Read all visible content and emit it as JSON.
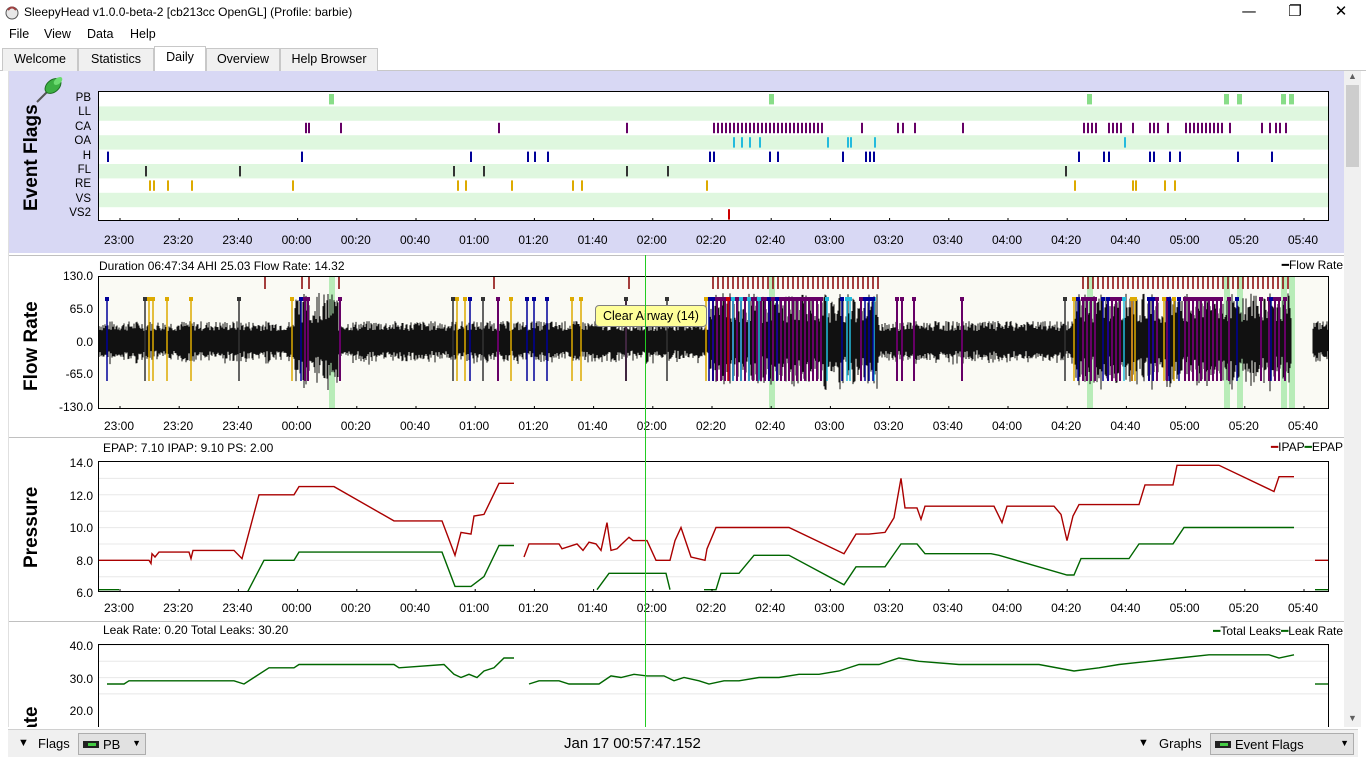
{
  "window": {
    "title": "SleepyHead v1.0.0-beta-2 [cb213cc OpenGL] (Profile: barbie)",
    "minimize": "—",
    "maximize": "❐",
    "close": "✕"
  },
  "menu": [
    "File",
    "View",
    "Data",
    "Help"
  ],
  "tabs": [
    "Welcome",
    "Statistics",
    "Daily",
    "Overview",
    "Help Browser"
  ],
  "active_tab": "Daily",
  "time_axis_labels": [
    "23:00",
    "23:20",
    "23:40",
    "00:00",
    "00:20",
    "00:40",
    "01:00",
    "01:20",
    "01:40",
    "02:00",
    "02:20",
    "02:40",
    "03:00",
    "03:20",
    "03:40",
    "04:00",
    "04:20",
    "04:40",
    "05:00",
    "05:20",
    "05:40"
  ],
  "event_flags": {
    "title": "Event Flags",
    "rows": [
      "PB",
      "LL",
      "CA",
      "OA",
      "H",
      "FL",
      "RE",
      "VS",
      "VS2"
    ],
    "colors": {
      "PB": "#88dd88",
      "CA": "#660066",
      "OA": "#22bbdd",
      "H": "#000099",
      "FL": "#333333",
      "RE": "#ddaa00",
      "VS2": "#cc0000"
    }
  },
  "flow_rate": {
    "title": "Flow Rate",
    "info": "Duration 06:47:34 AHI 25.03 Flow Rate: 14.32",
    "legend": "Flow Rate",
    "y_ticks": [
      "130.0",
      "65.0",
      "0.0",
      "-65.0",
      "-130.0"
    ],
    "tooltip": "Clear Airway (14)"
  },
  "pressure": {
    "title": "Pressure",
    "info": "EPAP: 7.10 IPAP: 9.10 PS: 2.00",
    "legend_ipap": "IPAP",
    "legend_epap": "EPAP",
    "y_ticks": [
      "14.0",
      "12.0",
      "10.0",
      "8.0",
      "6.0"
    ],
    "ipap_color": "#aa0000",
    "epap_color": "#006600"
  },
  "leak": {
    "title": "Leak Rate",
    "visible_title": "ak Rate",
    "info": "Leak Rate: 0.20 Total Leaks: 30.20",
    "legend_total": "Total Leaks",
    "legend_leak": "Leak Rate",
    "y_ticks": [
      "40.0",
      "30.0",
      "20.0"
    ],
    "color": "#006600"
  },
  "bottom": {
    "flags_label": "Flags",
    "flags_combo": "PB",
    "datetime": "Jan 17 00:57:47.152",
    "graphs_label": "Graphs",
    "graphs_combo": "Event Flags"
  }
}
